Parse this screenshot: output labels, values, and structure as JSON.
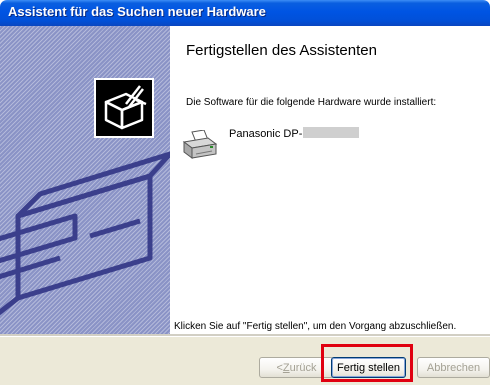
{
  "window": {
    "title": "Assistent für das Suchen neuer Hardware"
  },
  "content": {
    "heading": "Fertigstellen des Assistenten",
    "info_text": "Die Software für die folgende Hardware wurde installiert:",
    "device_name": "Panasonic DP-",
    "finish_text": "Klicken Sie auf \"Fertig stellen\", um den Vorgang abzuschließen."
  },
  "buttons": {
    "back_prefix": "< ",
    "back_mnemonic": "Z",
    "back_rest": "urück",
    "finish": "Fertig stellen",
    "cancel": "Abbrechen"
  },
  "icons": {
    "wizard": "hardware-wizard-icon",
    "device": "printer-icon"
  },
  "colors": {
    "titlebar": "#0054e3",
    "sidepanel": "#8a93c6",
    "footer": "#ece9d8",
    "highlight": "#e00010"
  }
}
